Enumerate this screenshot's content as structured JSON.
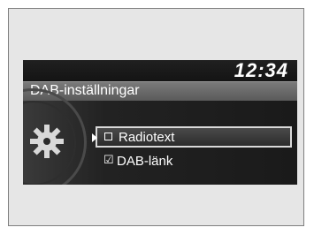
{
  "header": {
    "clock": "12:34",
    "title": "DAB-inställningar"
  },
  "menu": {
    "items": [
      {
        "label": "Radiotext",
        "checked": false,
        "selected": true
      },
      {
        "label": "DAB-länk",
        "checked": true,
        "selected": false
      }
    ]
  },
  "icons": {
    "settings": "gear-icon",
    "checkbox_off": "checkbox-empty-icon",
    "checkbox_on": "checkbox-checked-icon"
  }
}
